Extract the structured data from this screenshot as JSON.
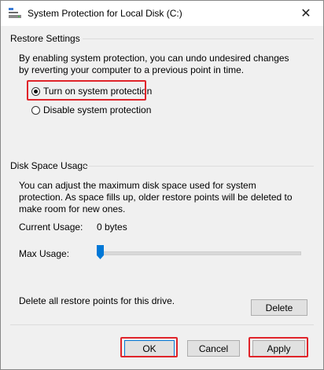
{
  "window": {
    "title": "System Protection for Local Disk (C:)",
    "close_glyph": "✕"
  },
  "restore_settings": {
    "heading": "Restore Settings",
    "description": "By enabling system protection, you can undo undesired changes by reverting your computer to a previous point in time.",
    "options": [
      {
        "label": "Turn on system protection",
        "checked": true,
        "highlighted": true
      },
      {
        "label": "Disable system protection",
        "checked": false,
        "highlighted": false
      }
    ]
  },
  "disk_space_usage": {
    "heading": "Disk Space Usage",
    "description": "You can adjust the maximum disk space used for system protection. As space fills up, older restore points will be deleted to make room for new ones.",
    "current_usage_label": "Current Usage:",
    "current_usage_value": "0 bytes",
    "max_usage_label": "Max Usage:",
    "max_usage_fraction": 0.0,
    "delete_text": "Delete all restore points for this drive.",
    "delete_button": "Delete"
  },
  "footer": {
    "ok_label": "OK",
    "cancel_label": "Cancel",
    "apply_label": "Apply"
  },
  "colors": {
    "highlight": "#e0242a",
    "accent": "#0078d7"
  },
  "icons": {
    "title": "drive-protection-icon",
    "close": "close-icon"
  }
}
